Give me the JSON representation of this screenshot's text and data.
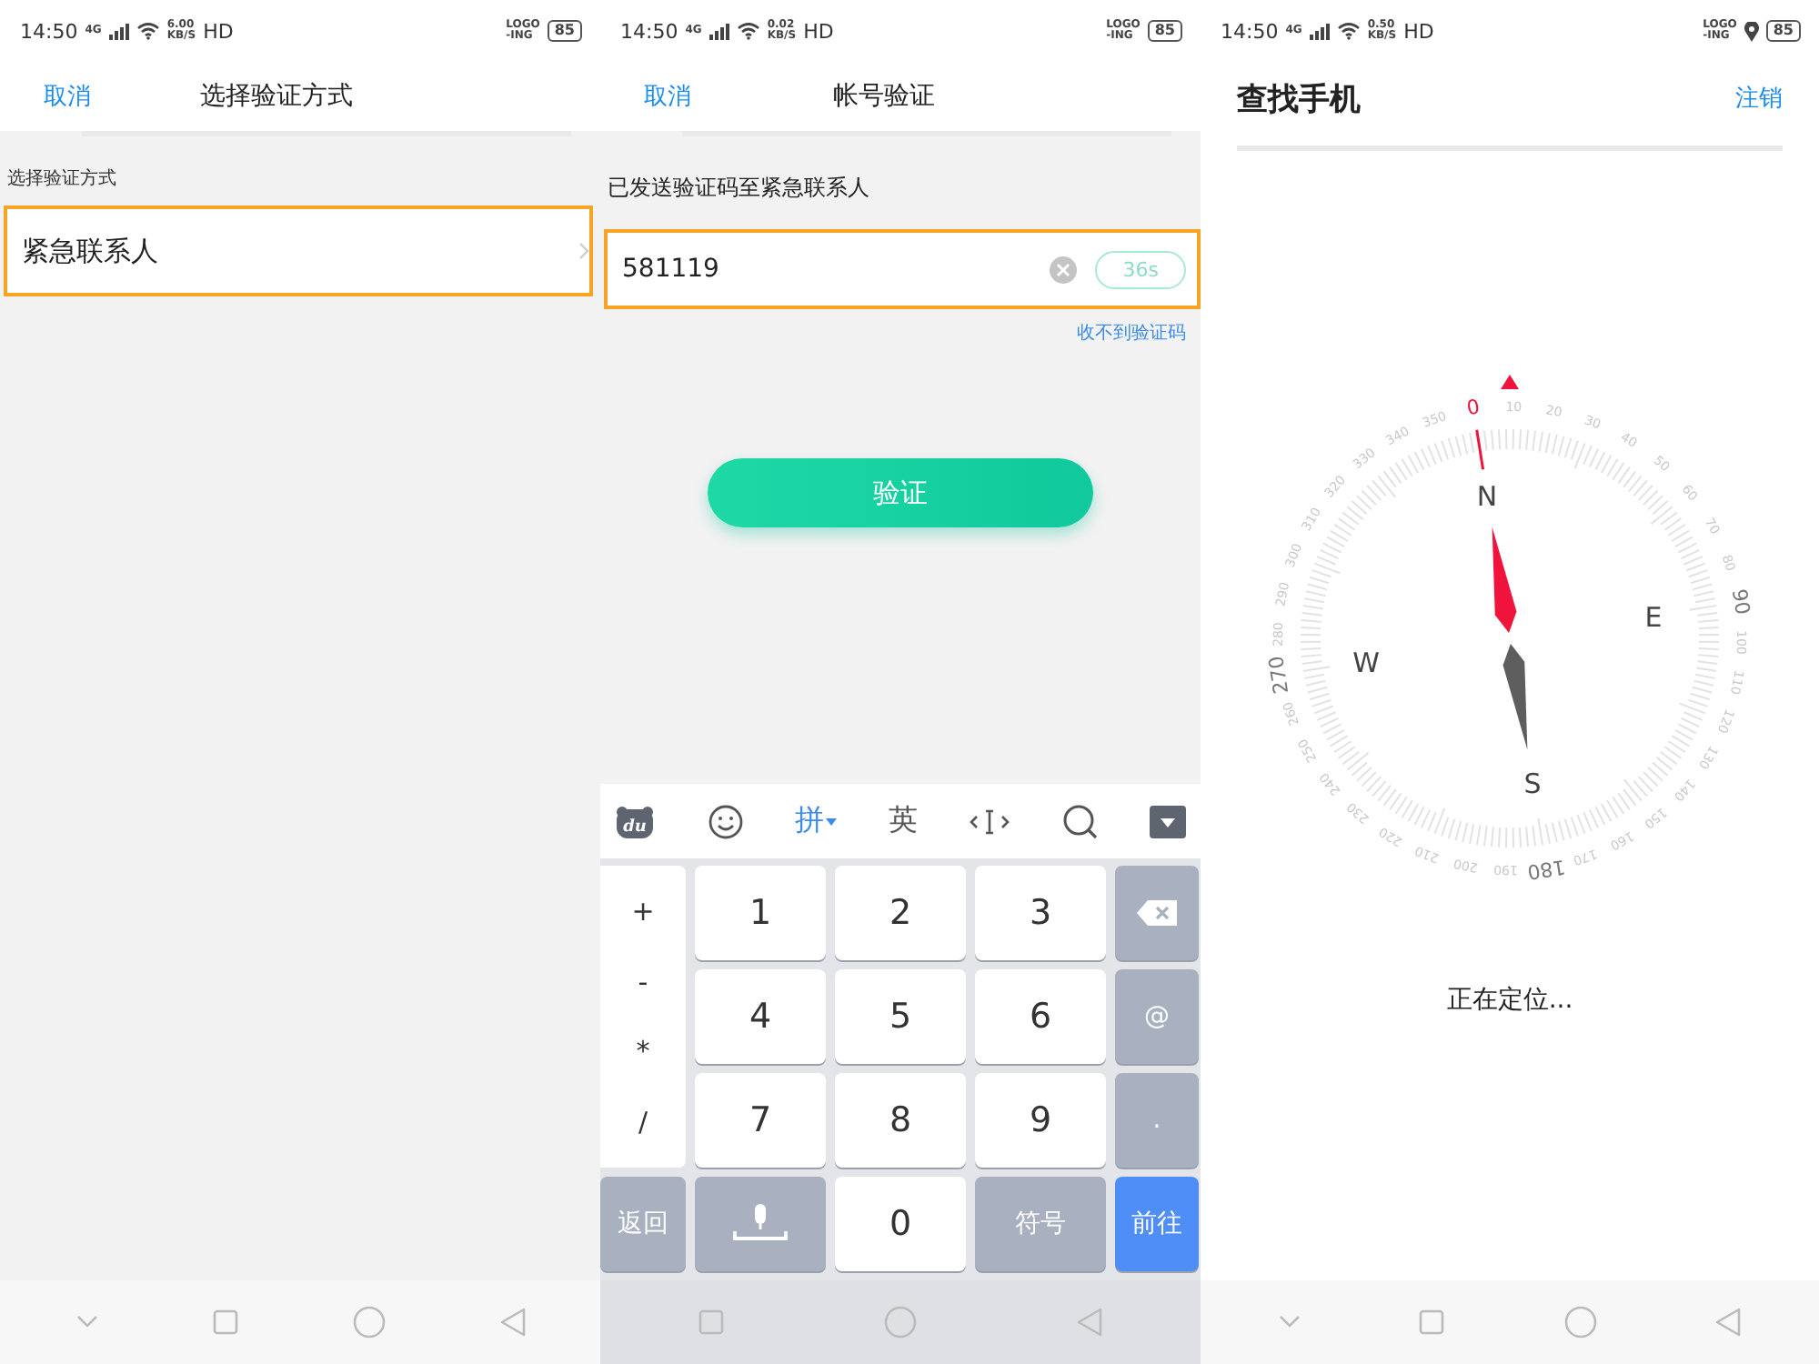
{
  "panels": [
    {
      "kind": "select_method",
      "status": {
        "time": "14:50",
        "network": "4G",
        "speed": "6.00",
        "speed_unit": "KB/S",
        "hd": "HD",
        "carrier_top": "LOGO",
        "carrier_bottom": "-ING",
        "battery": "85"
      },
      "header": {
        "cancel": "取消",
        "title": "选择验证方式"
      },
      "section_label": "选择验证方式",
      "option": {
        "label": "紧急联系人",
        "highlighted": true
      },
      "nav_buttons": [
        {
          "kind": "collapse"
        },
        {
          "kind": "recent"
        },
        {
          "kind": "home"
        },
        {
          "kind": "back"
        }
      ]
    },
    {
      "kind": "verify",
      "status": {
        "time": "14:50",
        "network": "4G",
        "speed": "0.02",
        "speed_unit": "KB/S",
        "hd": "HD",
        "carrier_top": "LOGO",
        "carrier_bottom": "-ING",
        "battery": "85"
      },
      "header": {
        "cancel": "取消",
        "title": "帐号验证"
      },
      "message": "已发送验证码至紧急联系人",
      "code_field": {
        "value": "581119",
        "highlighted": true,
        "countdown": "36s"
      },
      "resend_link": "收不到验证码",
      "submit": "验证",
      "keyboard": {
        "toolbar": [
          {
            "kind": "logo",
            "label": "du"
          },
          {
            "kind": "emoji"
          },
          {
            "kind": "text",
            "label": "拼",
            "selected": true
          },
          {
            "kind": "text",
            "label": "英",
            "selected": false
          },
          {
            "kind": "cursor"
          },
          {
            "kind": "search"
          },
          {
            "kind": "hide"
          }
        ],
        "symbols": [
          "+",
          "-",
          "*",
          "/"
        ],
        "digits": [
          "1",
          "2",
          "3",
          "4",
          "5",
          "6",
          "7",
          "8",
          "9"
        ],
        "side_keys": [
          {
            "kind": "backspace"
          },
          {
            "kind": "function",
            "label": "@"
          },
          {
            "kind": "function",
            "label": "."
          }
        ],
        "bottom_keys": [
          {
            "kind": "function",
            "label": "返回"
          },
          {
            "kind": "mic"
          },
          {
            "kind": "digit",
            "label": "0"
          },
          {
            "kind": "function",
            "label": "符号"
          },
          {
            "kind": "go",
            "label": "前往"
          }
        ]
      },
      "nav_buttons": [
        {
          "kind": "recent"
        },
        {
          "kind": "home"
        },
        {
          "kind": "back"
        }
      ]
    },
    {
      "kind": "find_phone",
      "status": {
        "time": "14:50",
        "network": "4G",
        "speed": "0.50",
        "speed_unit": "KB/S",
        "hd": "HD",
        "carrier_top": "LOGO",
        "carrier_bottom": "-ING",
        "location": true,
        "battery": "85"
      },
      "header": {
        "title": "查找手机",
        "action": "注销"
      },
      "compass": {
        "degree_labels": [
          "0",
          "10",
          "20",
          "30",
          "40",
          "50",
          "60",
          "70",
          "80",
          "90",
          "100",
          "110",
          "120",
          "130",
          "140",
          "150",
          "160",
          "170",
          "180",
          "190",
          "200",
          "210",
          "220",
          "230",
          "240",
          "250",
          "260",
          "270",
          "280",
          "290",
          "300",
          "310",
          "320",
          "330",
          "340",
          "350"
        ],
        "cardinals": [
          "N",
          "E",
          "S",
          "W"
        ]
      },
      "status_text": "正在定位...",
      "nav_buttons": [
        {
          "kind": "collapse"
        },
        {
          "kind": "recent"
        },
        {
          "kind": "home"
        },
        {
          "kind": "back"
        }
      ]
    }
  ]
}
